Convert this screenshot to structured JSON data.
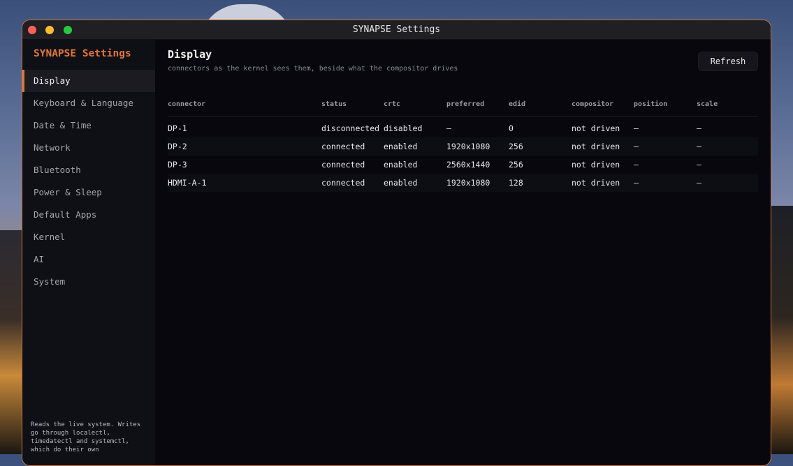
{
  "window": {
    "title": "SYNAPSE Settings"
  },
  "sidebar": {
    "brand": "SYNAPSE Settings",
    "items": [
      {
        "label": "Display",
        "active": true
      },
      {
        "label": "Keyboard & Language"
      },
      {
        "label": "Date & Time"
      },
      {
        "label": "Network"
      },
      {
        "label": "Bluetooth"
      },
      {
        "label": "Power & Sleep"
      },
      {
        "label": "Default Apps"
      },
      {
        "label": "Kernel"
      },
      {
        "label": "AI"
      },
      {
        "label": "System"
      }
    ],
    "footer": "Reads the live system. Writes go through localectl, timedatectl and systemctl, which do their own"
  },
  "main": {
    "title": "Display",
    "subtitle": "connectors as the kernel sees them, beside what the compositor drives",
    "refresh_label": "Refresh",
    "table": {
      "headers": [
        "connector",
        "status",
        "crtc",
        "preferred",
        "edid",
        "compositor",
        "position",
        "scale"
      ],
      "rows": [
        [
          "DP-1",
          "disconnected",
          "disabled",
          "–",
          "0",
          "not driven",
          "–",
          "–"
        ],
        [
          "DP-2",
          "connected",
          "enabled",
          "1920x1080",
          "256",
          "not driven",
          "–",
          "–"
        ],
        [
          "DP-3",
          "connected",
          "enabled",
          "2560x1440",
          "256",
          "not driven",
          "–",
          "–"
        ],
        [
          "HDMI-A-1",
          "connected",
          "enabled",
          "1920x1080",
          "128",
          "not driven",
          "–",
          "–"
        ]
      ]
    }
  },
  "colors": {
    "accent": "#e0773a",
    "status_ok": "#8fd66f",
    "status_warn": "#f0d27a",
    "compositor": "#f07f9c"
  }
}
